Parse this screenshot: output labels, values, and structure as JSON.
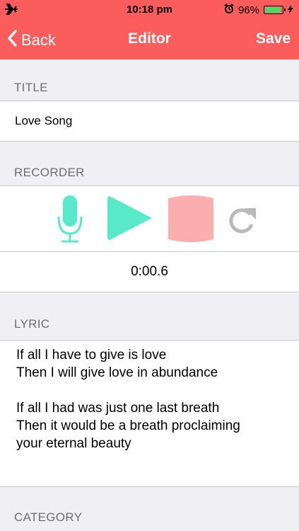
{
  "status": {
    "time": "10:18 pm",
    "battery": "96%",
    "battery_level": 0.96
  },
  "nav": {
    "back_label": "Back",
    "title": "Editor",
    "save_label": "Save"
  },
  "sections": {
    "title_header": "TITLE",
    "recorder_header": "RECORDER",
    "lyric_header": "LYRIC",
    "category_header": "CATEGORY"
  },
  "title_field": {
    "value": "Love Song"
  },
  "recorder": {
    "elapsed": "0:00.6"
  },
  "lyric": {
    "text": "If all I have to give is love\nThen I will give love in abundance\n\nIf all I had was just one last breath\nThen it would be a breath proclaiming\nyour eternal beauty"
  },
  "colors": {
    "accent": "#fa5d5b",
    "mint": "#57e9c9",
    "stop": "#fbaeb0",
    "refresh": "#b9b9b9"
  }
}
